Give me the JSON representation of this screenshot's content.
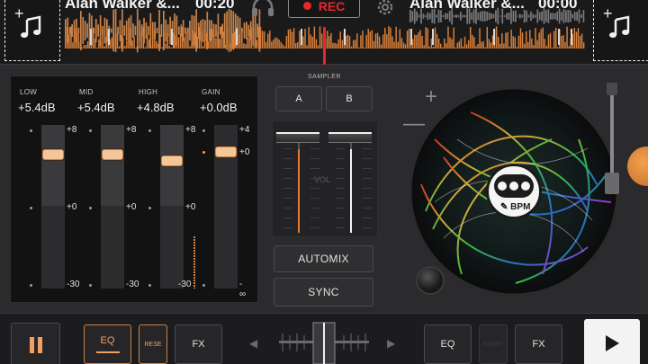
{
  "top": {
    "deck_a": {
      "title": "Alan Walker &...",
      "time": "00:20"
    },
    "deck_b": {
      "title": "Alan Walker &...",
      "time": "00:00"
    },
    "rec_label": "REC"
  },
  "eq": {
    "bands": [
      {
        "label": "LOW",
        "value": "+5.4dB",
        "marks": [
          "+8",
          "+0",
          "-30"
        ],
        "level": 0.63
      },
      {
        "label": "MID",
        "value": "+5.4dB",
        "marks": [
          "+8",
          "+0",
          "-30"
        ],
        "level": 0.63
      },
      {
        "label": "HIGH",
        "value": "+4.8dB",
        "marks": [
          "+8",
          "+0",
          "-30"
        ],
        "level": 0.6
      },
      {
        "label": "GAIN",
        "value": "+0.0dB",
        "marks": [
          "+4",
          "+0",
          "- ∞"
        ],
        "level": 0.5
      }
    ]
  },
  "sampler": {
    "title": "SAMPLER",
    "a_label": "A",
    "b_label": "B"
  },
  "volume": {
    "label": "VOL",
    "deck_a_level": 0.88,
    "deck_b_level": 0.88
  },
  "buttons": {
    "automix": "AUTOMIX",
    "sync": "SYNC"
  },
  "deck_b": {
    "bpm_label": "BPM",
    "plus": "+",
    "minus": "—"
  },
  "bottom": {
    "eq_a": "EQ",
    "reset_a": "RESE",
    "fx_a": "FX",
    "eq_b": "EQ",
    "reset_b": "RESET",
    "fx_b": "FX",
    "cf_left": "◀",
    "cf_right": "▶"
  },
  "colors": {
    "accent": "#f0a060",
    "rec": "#e8262b",
    "panel": "#121213"
  },
  "icons": {
    "deck_a_tile": "music-note-icon",
    "deck_b_tile": "music-note-icon",
    "headphones": "headphones-icon",
    "settings": "gear-icon",
    "pause": "pause-icon",
    "play": "play-icon"
  }
}
